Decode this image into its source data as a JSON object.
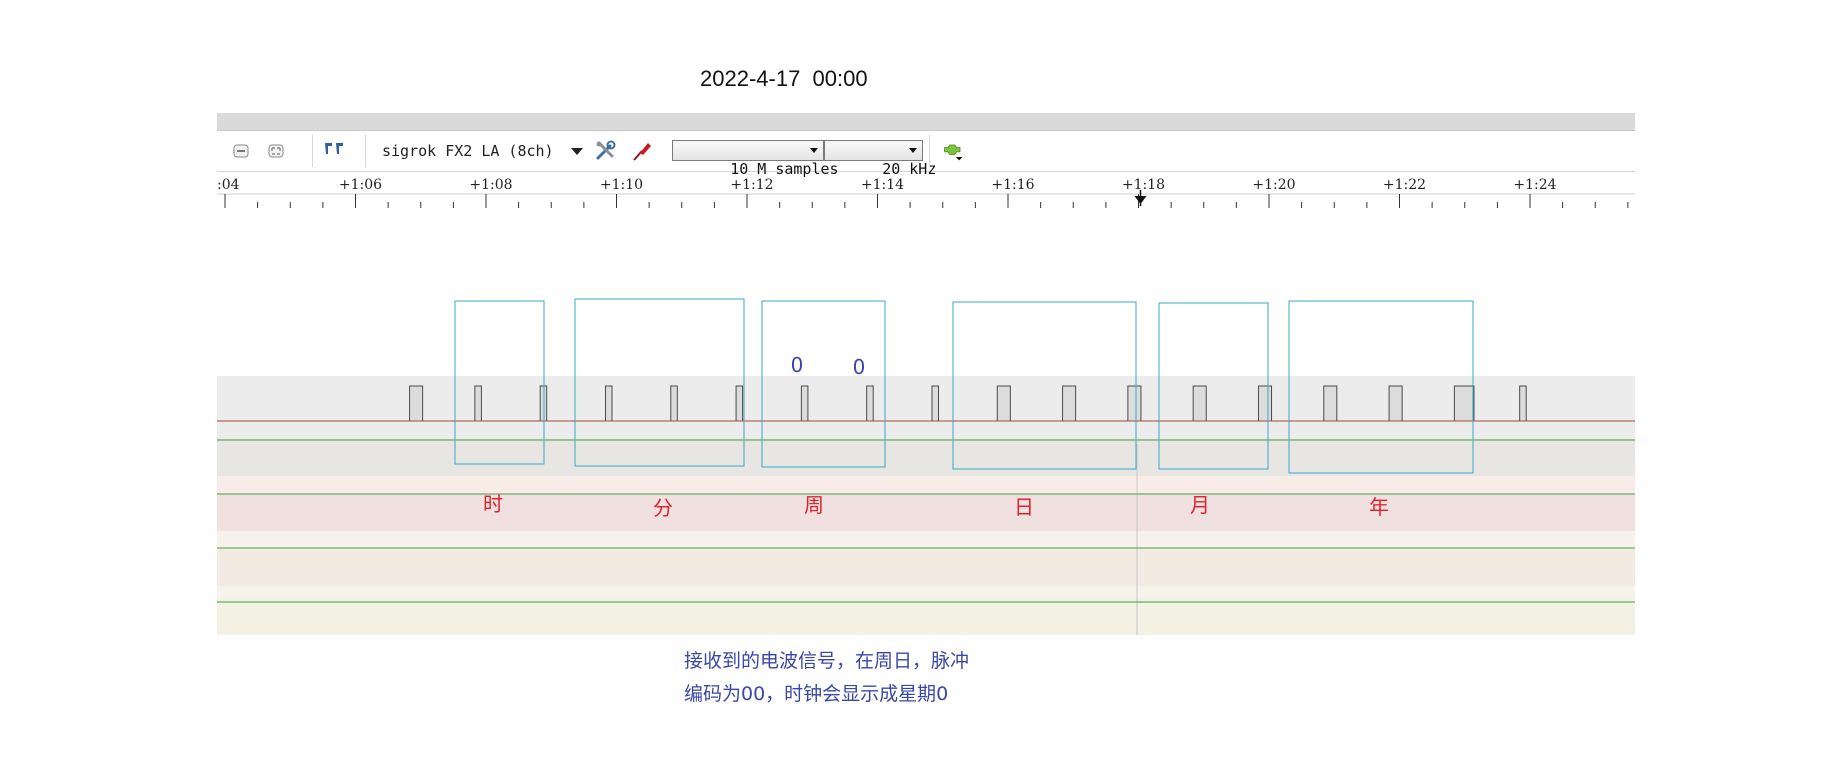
{
  "header": {
    "datetime": "2022-4-17  00:00"
  },
  "toolbar": {
    "device": "sigrok FX2 LA (8ch)",
    "samples": "10 M samples",
    "rate": "20 kHz",
    "icons": [
      "zoom-fit-icon",
      "zoom-original-icon",
      "cursor-marker-icon",
      "configure-device-icon",
      "probe-icon",
      "decoder-icon"
    ]
  },
  "ruler": {
    "ticks": [
      ":04",
      "+1:06",
      "+1:08",
      "+1:10",
      "+1:12",
      "+1:14",
      "+1:16",
      "+1:18",
      "+1:20",
      "+1:22",
      "+1:24"
    ],
    "trigger_marker": "+1:18"
  },
  "annotations": {
    "group_labels": [
      "时",
      "分",
      "周",
      "日",
      "月",
      "年"
    ],
    "bit_values": [
      "0",
      "0"
    ]
  },
  "caption": {
    "line1": "接收到的电波信号，在周日，脉冲",
    "line2": "编码为00，时钟会显示成星期0"
  },
  "colors": {
    "trace_high": "#9e4a3c",
    "trace_low": "#9e4a3c",
    "group_box": "#3aa8c8",
    "label_red": "#e0242d",
    "bit_blue": "#3b47a8",
    "channel_line": "#3fa03f"
  },
  "signal": {
    "description_hidden": true,
    "pulse_starts_sec": [
      66.75,
      67.75,
      68.75,
      69.75,
      70.75,
      71.75,
      72.75,
      73.75,
      74.75,
      75.75,
      76.75,
      77.75,
      78.75,
      79.75,
      80.75,
      81.75,
      82.75,
      83.75
    ],
    "pulse_widths_sec": [
      0.2,
      0.1,
      0.1,
      0.1,
      0.1,
      0.1,
      0.1,
      0.1,
      0.1,
      0.2,
      0.2,
      0.2,
      0.2,
      0.2,
      0.2,
      0.2,
      0.3,
      0.1
    ]
  }
}
